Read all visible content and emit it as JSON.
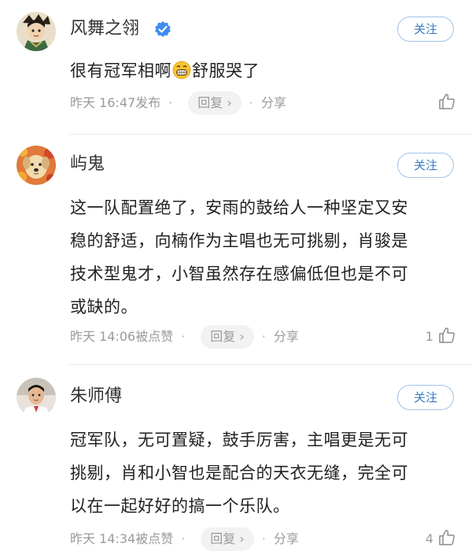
{
  "comments": [
    {
      "username": "风舞之翎",
      "verified": true,
      "follow_label": "关注",
      "text_before_emoji": "很有冠军相啊",
      "emoji": "grinning-emoji",
      "text_after_emoji": "舒服哭了",
      "time": "昨天 16:47发布",
      "reply_label": "回复 ›",
      "share_label": "分享",
      "like_count": ""
    },
    {
      "username": "屿鬼",
      "verified": false,
      "follow_label": "关注",
      "text_lines": [
        "这一队配置绝了，安雨的鼓给人一种坚定又安",
        "稳的舒适，向楠作为主唱也无可挑剔，肖骏是",
        "技术型鬼才，小智虽然存在感偏低但也是不可",
        "或缺的。"
      ],
      "time": "昨天 14:06被点赞",
      "reply_label": "回复 ›",
      "share_label": "分享",
      "like_count": "1"
    },
    {
      "username": "朱师傅",
      "verified": false,
      "follow_label": "关注",
      "text_lines": [
        "冠军队，无可置疑，鼓手厉害，主唱更是无可",
        "挑剔，肖和小智也是配合的天衣无缝，完全可",
        "以在一起好好的搞一个乐队。"
      ],
      "time": "昨天 14:34被点赞",
      "reply_label": "回复 ›",
      "share_label": "分享",
      "like_count": "4"
    }
  ],
  "colors": {
    "follow_border": "#9fc4e8",
    "follow_text": "#3a79c0",
    "verified_badge": "#3d8cf0",
    "meta_text": "#9a9a9a",
    "divider": "#ececec"
  },
  "icons": [
    "verified-badge-icon",
    "grinning-emoji-icon",
    "thumbs-up-icon",
    "chevron-right-icon"
  ]
}
